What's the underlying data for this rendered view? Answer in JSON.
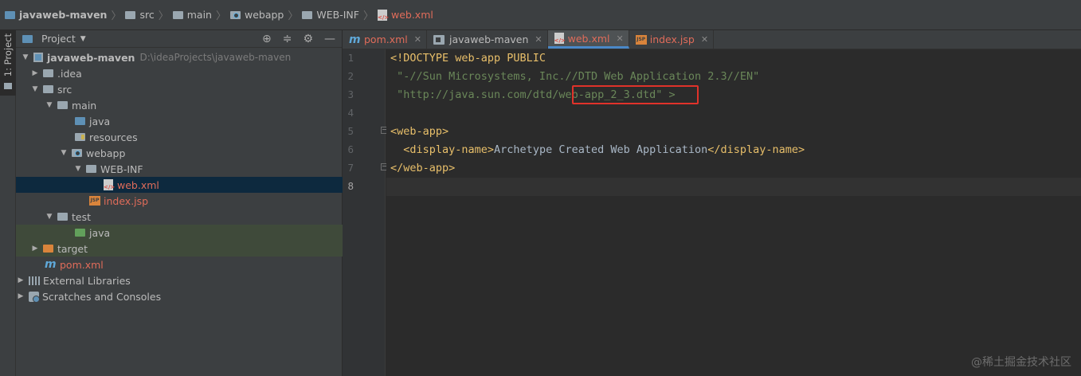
{
  "breadcrumb": {
    "items": [
      {
        "label": "javaweb-maven",
        "icon": "module-folder-icon"
      },
      {
        "label": "src",
        "icon": "folder-icon"
      },
      {
        "label": "main",
        "icon": "folder-icon"
      },
      {
        "label": "webapp",
        "icon": "web-folder-icon"
      },
      {
        "label": "WEB-INF",
        "icon": "folder-icon"
      },
      {
        "label": "web.xml",
        "icon": "xml-file-icon"
      }
    ]
  },
  "side_strip": {
    "project_tab_label": "1: Project"
  },
  "project_panel": {
    "title": "Project",
    "tree": [
      {
        "label": "javaweb-maven",
        "path": "D:\\ideaProjects\\javaweb-maven",
        "depth": 0,
        "expanded": true,
        "icon": "module-icon"
      },
      {
        "label": ".idea",
        "depth": 1,
        "expanded": false,
        "icon": "folder-icon"
      },
      {
        "label": "src",
        "depth": 1,
        "expanded": true,
        "icon": "folder-icon"
      },
      {
        "label": "main",
        "depth": 2,
        "expanded": true,
        "icon": "folder-icon"
      },
      {
        "label": "java",
        "depth": 3,
        "icon": "source-folder-icon"
      },
      {
        "label": "resources",
        "depth": 3,
        "icon": "resources-folder-icon"
      },
      {
        "label": "webapp",
        "depth": 3,
        "expanded": true,
        "icon": "web-folder-icon"
      },
      {
        "label": "WEB-INF",
        "depth": 4,
        "expanded": true,
        "icon": "folder-icon"
      },
      {
        "label": "web.xml",
        "depth": 5,
        "icon": "xml-file-icon",
        "selected": true
      },
      {
        "label": "index.jsp",
        "depth": 4,
        "icon": "jsp-file-icon"
      },
      {
        "label": "test",
        "depth": 2,
        "expanded": true,
        "icon": "folder-icon"
      },
      {
        "label": "java",
        "depth": 3,
        "icon": "test-source-folder-icon",
        "highlighted": true
      },
      {
        "label": "target",
        "depth": 1,
        "expanded": false,
        "icon": "excluded-folder-icon",
        "highlighted": true
      },
      {
        "label": "pom.xml",
        "depth": 1,
        "icon": "maven-file-icon"
      },
      {
        "label": "External Libraries",
        "depth": 0,
        "expanded": false,
        "icon": "libraries-icon"
      },
      {
        "label": "Scratches and Consoles",
        "depth": 0,
        "expanded": false,
        "icon": "scratches-icon"
      }
    ]
  },
  "editor_tabs": [
    {
      "label": "pom.xml",
      "icon": "maven-file-icon",
      "active": false
    },
    {
      "label": "javaweb-maven",
      "icon": "module-icon",
      "active": false
    },
    {
      "label": "web.xml",
      "icon": "xml-file-icon",
      "active": true
    },
    {
      "label": "index.jsp",
      "icon": "jsp-file-icon",
      "active": false
    }
  ],
  "code": {
    "line_numbers": [
      "1",
      "2",
      "3",
      "4",
      "5",
      "6",
      "7",
      "8"
    ],
    "l1": "<!DOCTYPE web-app PUBLIC",
    "l2": " \"-//Sun Microsystems, Inc.//DTD Web Application 2.3//EN\"",
    "l3": " \"http://java.sun.com/dtd/web-app_2_3.dtd\" >",
    "l5": "<web-app>",
    "l6_open": "  <display-name>",
    "l6_text": "Archetype Created Web Application",
    "l6_close": "</display-name>",
    "l7": "</web-app>"
  },
  "colors": {
    "highlight_box": "#e0322a",
    "active_file": "#e06c5a"
  },
  "watermark": "@稀土掘金技术社区"
}
